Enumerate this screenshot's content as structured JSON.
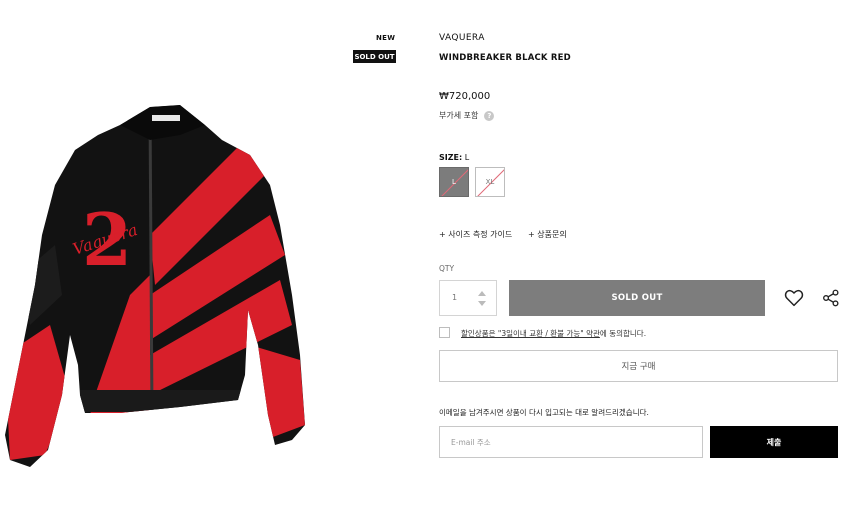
{
  "badges": {
    "new": "NEW",
    "sold_out": "SOLD OUT"
  },
  "product": {
    "brand": "VAQUERA",
    "name": "WINDBREAKER BLACK RED",
    "price": "₩720,000",
    "vat_note": "부가세 포함",
    "help_glyph": "?",
    "image_icon": "product-photo-jacket",
    "colors": {
      "jacket_black": "#111111",
      "jacket_red": "#d81f2a"
    }
  },
  "size": {
    "label": "SIZE:",
    "selected": "L",
    "options": [
      {
        "label": "L",
        "selected": true,
        "sold_out": true
      },
      {
        "label": "XL",
        "selected": false,
        "sold_out": true
      }
    ]
  },
  "links": {
    "size_guide": "+ 사이즈 측정 가이드",
    "inquiry": "+ 상품문의"
  },
  "quantity": {
    "label": "QTY",
    "value": "1"
  },
  "actions": {
    "sold_out_label": "SOLD OUT",
    "wishlist_icon": "heart-icon",
    "share_icon": "share-icon"
  },
  "agreement": {
    "checked": false,
    "link_text": "할인상품은 \"3일이내 교환 / 환불 가능\" 약관",
    "suffix": "에 동의합니다."
  },
  "buy_now": "지금 구매",
  "restock": {
    "message": "이메일을 남겨주시면 상품이 다시 입고되는 대로 알려드리겠습니다.",
    "email_placeholder": "E-mail 주소",
    "email_value": "",
    "submit_label": "제출"
  },
  "theme": {
    "accent": "#000000",
    "disabled_button": "#7d7d7d",
    "border": "#c8c8c8"
  }
}
